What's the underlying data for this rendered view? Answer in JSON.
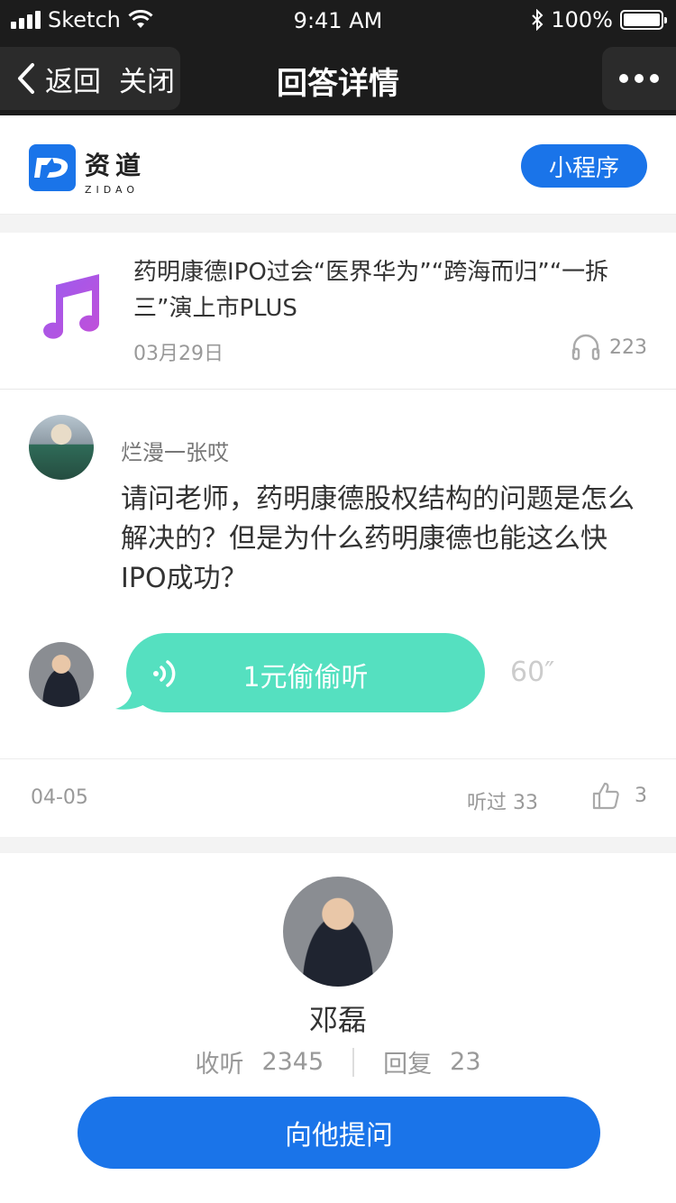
{
  "status_bar": {
    "carrier": "Sketch",
    "time": "9:41 AM",
    "battery": "100%"
  },
  "nav": {
    "back_label": "返回",
    "close_label": "关闭",
    "title": "回答详情"
  },
  "brand": {
    "name_cn": "资道",
    "name_en": "ZIDAO",
    "mini_program_label": "小程序"
  },
  "track": {
    "title": "药明康德IPO过会“医界华为”“跨海而归”“一拆三”演上市PLUS",
    "date": "03月29日",
    "listen_count": "223"
  },
  "question": {
    "asker_name": "烂漫一张哎",
    "text": "请问老师，药明康德股权结构的问题是怎么解决的？但是为什么药明康德也能这么快IPO成功？"
  },
  "answer": {
    "bubble_label": "1元偷偷听",
    "duration": "60″"
  },
  "meta": {
    "date": "04-05",
    "listened": "听过 33",
    "likes": "3"
  },
  "profile": {
    "name": "邓磊",
    "listen_label": "收听",
    "listen_count": "2345",
    "reply_label": "回复",
    "reply_count": "23",
    "ask_button": "向他提问"
  },
  "colors": {
    "accent": "#1a74e9",
    "bubble": "#55e0c0",
    "nav_bg": "#1c1c1c"
  }
}
